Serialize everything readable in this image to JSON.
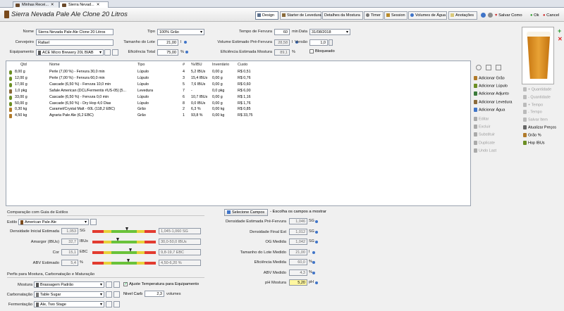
{
  "tabs": [
    {
      "label": "Minhas Recei..."
    },
    {
      "label": "Sierra Nevad..."
    }
  ],
  "tab_close": "✕",
  "recipe_title": "Sierra Nevada Pale Ale Clone 20 Litros",
  "toolbar": {
    "design": "Design",
    "starter": "Starter de Levedura",
    "mash_details": "Detalhes da Mostura",
    "timer": "Timer",
    "session": "Session",
    "water": "Volumes de Água",
    "notes": "Anotações",
    "save_as": "Salvar Como",
    "ok": "Ok",
    "cancel": "Cancel"
  },
  "form": {
    "name_label": "Nome",
    "name_value": "Sierra Nevada Pale Ale Clone 20 Litros",
    "brewer_label": "Cervejeiro",
    "brewer_value": "Rafael",
    "equipment_label": "Equipamento",
    "equipment_value": "ACE Micro Brewery 20L BIAB",
    "type_label": "Tipo",
    "type_value": "100% Grão",
    "batch_label": "Tamanho do Lote",
    "batch_value": "21,00",
    "batch_unit": "l",
    "efficiency_label": "Eficiência Total",
    "efficiency_value": "75,00",
    "efficiency_unit": "%",
    "boil_time_label": "Tempo de Fervura",
    "boil_time_value": "60",
    "boil_time_unit": "min",
    "preboil_label": "Volume Estimado Pré-Fervura",
    "preboil_value": "28,58",
    "preboil_unit": "l",
    "mash_eff_label": "Eficiência Estimada Mostura",
    "mash_eff_value": "89,1",
    "mash_eff_unit": "%",
    "date_label": "Data",
    "date_value": "31/08/2018",
    "version_label": "Versão",
    "version_value": "1,0",
    "locked_label": "Bloqueado"
  },
  "grid": {
    "headers": [
      "Qtd",
      "Nome",
      "Tipo",
      "#",
      "%/IBU",
      "Inventário",
      "Custo"
    ],
    "rows": [
      {
        "qty": "8,00 g",
        "name": "Perle (7,00 %) - Fervura 30,0 min",
        "type": "Lúpulo",
        "num": "4",
        "ibu": "5,2 IBUs",
        "inv": "0,00 g",
        "cost": "R$ 0,51",
        "icon": "hop"
      },
      {
        "qty": "12,00 g",
        "name": "Perle (7,00 %) - Fervura 60,0 min",
        "type": "Lúpulo",
        "num": "3",
        "ibu": "15,4 IBUs",
        "inv": "0,00 g",
        "cost": "R$ 0,76",
        "icon": "hop"
      },
      {
        "qty": "17,00 g",
        "name": "Cascade (6,50 %) - Fervura 10,0 min",
        "type": "Lúpulo",
        "num": "5",
        "ibu": "7,6 IBUs",
        "inv": "0,00 g",
        "cost": "R$ 0,60",
        "icon": "hop"
      },
      {
        "qty": "1,0 pkg",
        "name": "Safale American  (DCL/Fermentis #US-05) [5...",
        "type": "Levedura",
        "num": "7",
        "ibu": "-",
        "inv": "0,0 pkg",
        "cost": "R$ 6,00",
        "icon": "yeast"
      },
      {
        "qty": "33,00 g",
        "name": "Cascade (6,50 %) - Fervura 0,0 min",
        "type": "Lúpulo",
        "num": "6",
        "ibu": "10,7 IBUs",
        "inv": "0,00 g",
        "cost": "R$ 1,16",
        "icon": "hop"
      },
      {
        "qty": "50,00 g",
        "name": "Cascade (6,50 %) - Dry Hop 4,0 Dias",
        "type": "Lúpulo",
        "num": "8",
        "ibu": "0,0 IBUs",
        "inv": "0,00 g",
        "cost": "R$ 1,76",
        "icon": "hop"
      },
      {
        "qty": "0,30 kg",
        "name": "Caramel/Crystal Malt - 60L (118,2 EBC)",
        "type": "Grão",
        "num": "2",
        "ibu": "6,3 %",
        "inv": "0,00 kg",
        "cost": "R$ 0,85",
        "icon": "grain"
      },
      {
        "qty": "4,50 kg",
        "name": "Agraria Pale Ale (6,2 EBC)",
        "type": "Grão",
        "num": "1",
        "ibu": "93,8 %",
        "inv": "0,00 kg",
        "cost": "R$ 33,75",
        "icon": "grain"
      }
    ]
  },
  "actions": [
    {
      "label": "Adicionar Grão",
      "enabled": true,
      "icon": "grain"
    },
    {
      "label": "Adicionar Lúpulo",
      "enabled": true,
      "icon": "hop"
    },
    {
      "label": "Adicionar Adjunto",
      "enabled": true,
      "icon": "adjunct"
    },
    {
      "label": "Adicionar Levedura",
      "enabled": true,
      "icon": "yeast"
    },
    {
      "label": "Adicionar Água",
      "enabled": true,
      "icon": "water"
    },
    {
      "label": "Editar",
      "enabled": false,
      "icon": "edit"
    },
    {
      "label": "Excluir",
      "enabled": false,
      "icon": "delete"
    },
    {
      "label": "Substituir",
      "enabled": false,
      "icon": "replace"
    },
    {
      "label": "Duplicate",
      "enabled": false,
      "icon": "duplicate"
    },
    {
      "label": "Undo Last",
      "enabled": false,
      "icon": "undo"
    }
  ],
  "actions2": [
    {
      "label": "+ Quantidade",
      "enabled": false
    },
    {
      "label": "- Quantidade",
      "enabled": false
    },
    {
      "label": "+ Tempo",
      "enabled": false
    },
    {
      "label": "- Tempo",
      "enabled": false
    },
    {
      "label": "Salvar Item",
      "enabled": false
    },
    {
      "label": "Atualizar Preços",
      "enabled": true
    },
    {
      "label": "Grão %",
      "enabled": true
    },
    {
      "label": "Hop IBUs",
      "enabled": true
    }
  ],
  "style": {
    "section_title": "Comparação com Guia de Estilos",
    "style_label": "Estilo",
    "style_value": "American Pale Ale",
    "rows": [
      {
        "label": "Densidade Inicial Estimada",
        "value": "1,053",
        "unit": "SG",
        "range": "1,045-1,060 SG",
        "marker": 0.55
      },
      {
        "label": "Amargor (IBUs)",
        "value": "32,7",
        "unit": "IBUs",
        "range": "30,0-50,0 IBUs",
        "marker": 0.4
      },
      {
        "label": "Cor",
        "value": "15,1",
        "unit": "EBC",
        "range": "9,8-19,7 EBC",
        "marker": 0.6
      },
      {
        "label": "ABV Estimado",
        "value": "5,4",
        "unit": "%",
        "range": "4,50-6,20 %",
        "marker": 0.57
      }
    ]
  },
  "profiles": {
    "section_title": "Perfis para Mostura, Carbonatação e Maturação",
    "mash_label": "Mostura",
    "mash_value": "Brassagem Padrão",
    "carb_label": "Carbonatação",
    "carb_value": "Table Sugar",
    "ferm_label": "Fermentação",
    "ferm_value": "Ale, Two Stage",
    "adjust_label": "Ajuste Temperatura para Equipamento",
    "carb_level_label": "Nivel Carb",
    "carb_level_value": "2,3",
    "carb_level_unit": "volumes"
  },
  "fields": {
    "select_button": "Selecione Campos",
    "hint": "- Escolha os campos a mostrar",
    "rows": [
      {
        "label": "Densidade Estimada Pré-Fervura",
        "value": "1,046",
        "unit": "SG",
        "highlight": false
      },
      {
        "label": "Densidade Final Est",
        "value": "1,012",
        "unit": "SG",
        "highlight": false
      },
      {
        "label": "OG Medida",
        "value": "1,042",
        "unit": "SG",
        "highlight": false
      },
      {
        "label": "Tamanho do Lote Medido",
        "value": "21,00",
        "unit": "l",
        "highlight": false
      },
      {
        "label": "Eficiência Medida",
        "value": "60,0",
        "unit": "%",
        "highlight": false
      },
      {
        "label": "ABV Medido",
        "value": "4,3",
        "unit": "%",
        "highlight": false
      },
      {
        "label": "pH Mostura",
        "value": "5,20",
        "unit": "pH",
        "highlight": true
      }
    ]
  },
  "colors": {
    "beer": "#d98a1c",
    "accent": "#3f74c8",
    "hop": "#6b8e23",
    "grain": "#b07a2a",
    "yeast": "#8a6a3a"
  }
}
